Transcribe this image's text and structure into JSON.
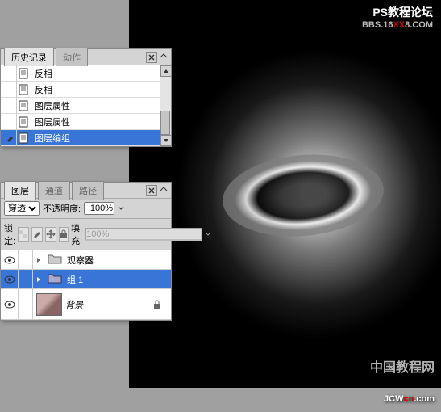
{
  "watermarks": {
    "title": "PS教程论坛",
    "url_pre": "BBS.16",
    "url_mid": "XX",
    "url_post": "8.COM",
    "cn_tutorial": "中国教程网",
    "jcw_pre": "JCW",
    "jcw_mid": "cn",
    "jcw_post": ".com"
  },
  "history": {
    "tabs": [
      "历史记录",
      "动作"
    ],
    "items": [
      {
        "label": "反相",
        "type": "invert"
      },
      {
        "label": "反相",
        "type": "invert"
      },
      {
        "label": "图层属性",
        "type": "layer-prop"
      },
      {
        "label": "图层属性",
        "type": "layer-prop"
      },
      {
        "label": "图层编组",
        "type": "layer-group",
        "selected": true
      }
    ]
  },
  "layers": {
    "tabs": [
      "图层",
      "通道",
      "路径"
    ],
    "blend_mode": "穿透",
    "opacity_label": "不透明度:",
    "opacity_value": "100%",
    "lock_label": "锁定:",
    "fill_label": "填充:",
    "fill_value": "100%",
    "items": [
      {
        "name": "观察器",
        "type": "folder",
        "visible": true
      },
      {
        "name": "组 1",
        "type": "folder",
        "visible": true,
        "selected": true
      },
      {
        "name": "背景",
        "type": "bg",
        "visible": true,
        "locked": true,
        "italic": true
      }
    ]
  }
}
